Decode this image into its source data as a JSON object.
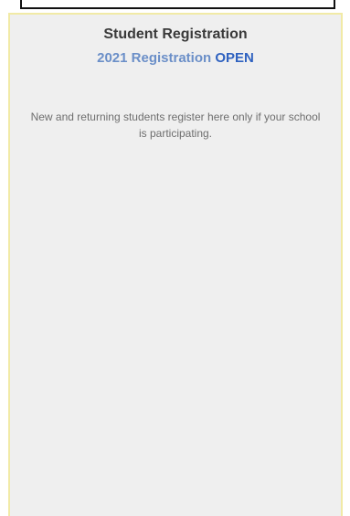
{
  "panel": {
    "title": "Student Registration",
    "subtitle_prefix": "2021 Registration",
    "subtitle_status": "OPEN",
    "description": "New and returning students register here only if your school is participating."
  },
  "colors": {
    "panel_background": "#efefef",
    "panel_border": "#f1eaa6",
    "subtitle_prefix": "#6b8fc8",
    "subtitle_status": "#2f62c0"
  }
}
